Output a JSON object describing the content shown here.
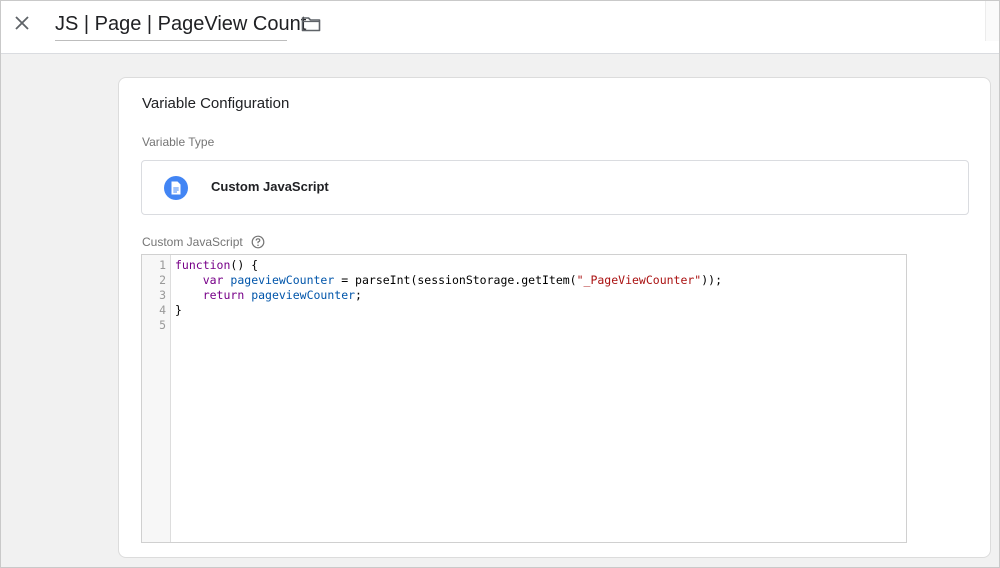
{
  "header": {
    "variable_name": "JS | Page | PageView Count",
    "close_icon": "close-icon",
    "folder_icon": "folder-icon"
  },
  "card": {
    "title": "Variable Configuration",
    "variable_type_label": "Variable Type",
    "variable_type": {
      "name": "Custom JavaScript",
      "icon": "document-icon",
      "icon_color": "#4285f4"
    },
    "code_label": "Custom JavaScript",
    "help_icon": "help-icon"
  },
  "editor": {
    "line_numbers": [
      "1",
      "2",
      "3",
      "4",
      "5"
    ],
    "lines": [
      [
        {
          "t": "function",
          "c": "kw"
        },
        {
          "t": "() {",
          "c": ""
        }
      ],
      [
        {
          "t": "    ",
          "c": ""
        },
        {
          "t": "var",
          "c": "kw"
        },
        {
          "t": " ",
          "c": ""
        },
        {
          "t": "pageviewCounter",
          "c": "var"
        },
        {
          "t": " = parseInt(sessionStorage.getItem(",
          "c": ""
        },
        {
          "t": "\"_PageViewCounter\"",
          "c": "str"
        },
        {
          "t": "));",
          "c": ""
        }
      ],
      [
        {
          "t": "    ",
          "c": ""
        },
        {
          "t": "return",
          "c": "kw"
        },
        {
          "t": " ",
          "c": ""
        },
        {
          "t": "pageviewCounter",
          "c": "var"
        },
        {
          "t": ";",
          "c": ""
        }
      ],
      [
        {
          "t": "}",
          "c": ""
        }
      ],
      []
    ]
  }
}
